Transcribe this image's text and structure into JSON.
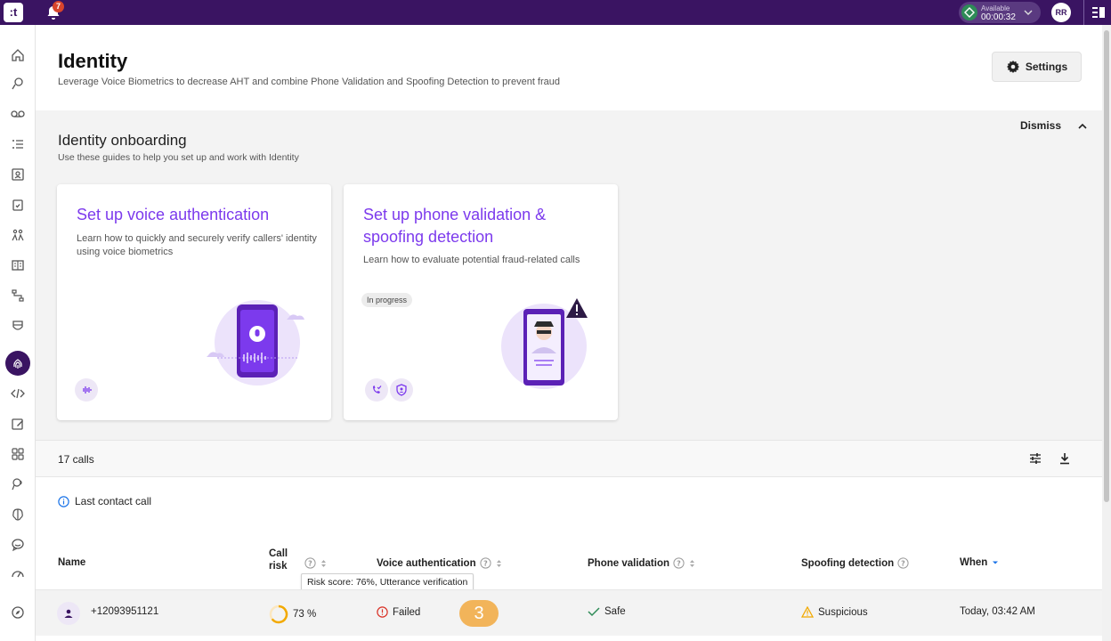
{
  "topbar": {
    "logo_text": ":t",
    "notifications_count": "7",
    "status_label": "Available",
    "status_time": "00:00:32",
    "user_initials": "RR"
  },
  "header": {
    "title": "Identity",
    "subtitle": "Leverage Voice Biometrics to decrease AHT and combine Phone Validation and Spoofing Detection to prevent fraud",
    "settings_label": "Settings"
  },
  "onboarding": {
    "title": "Identity onboarding",
    "subtitle": "Use these guides to help you set up and work with Identity",
    "dismiss_label": "Dismiss",
    "cards": [
      {
        "title": "Set up voice authentication",
        "description": "Learn how to quickly and securely verify callers' identity using voice biometrics"
      },
      {
        "title_line1": "Set up phone validation &",
        "title_line2": "spoofing detection",
        "description": "Learn how to evaluate potential fraud-related calls",
        "status": "In progress"
      }
    ]
  },
  "calls": {
    "count_label": "17 calls",
    "last_contact_label": "Last contact call",
    "columns": {
      "name": "Name",
      "call_risk_line1": "Call",
      "call_risk_line2": "risk",
      "voice_auth": "Voice authentication",
      "phone_validation": "Phone validation",
      "spoofing": "Spoofing detection",
      "when": "When"
    },
    "tooltip": "Risk score: 76%, Utterance verification",
    "rows": [
      {
        "name": "+12093951121",
        "risk": "73 %",
        "voice_auth": "Failed",
        "phone_validation": "Safe",
        "spoofing": "Suspicious",
        "when": "Today, 03:42 AM"
      }
    ],
    "step_badge": "3"
  },
  "colors": {
    "brand": "#3a1462",
    "accent": "#7c3aed",
    "fail": "#d93025",
    "safe": "#2e8b57",
    "warn": "#f2a900",
    "step": "#f2b45a"
  }
}
